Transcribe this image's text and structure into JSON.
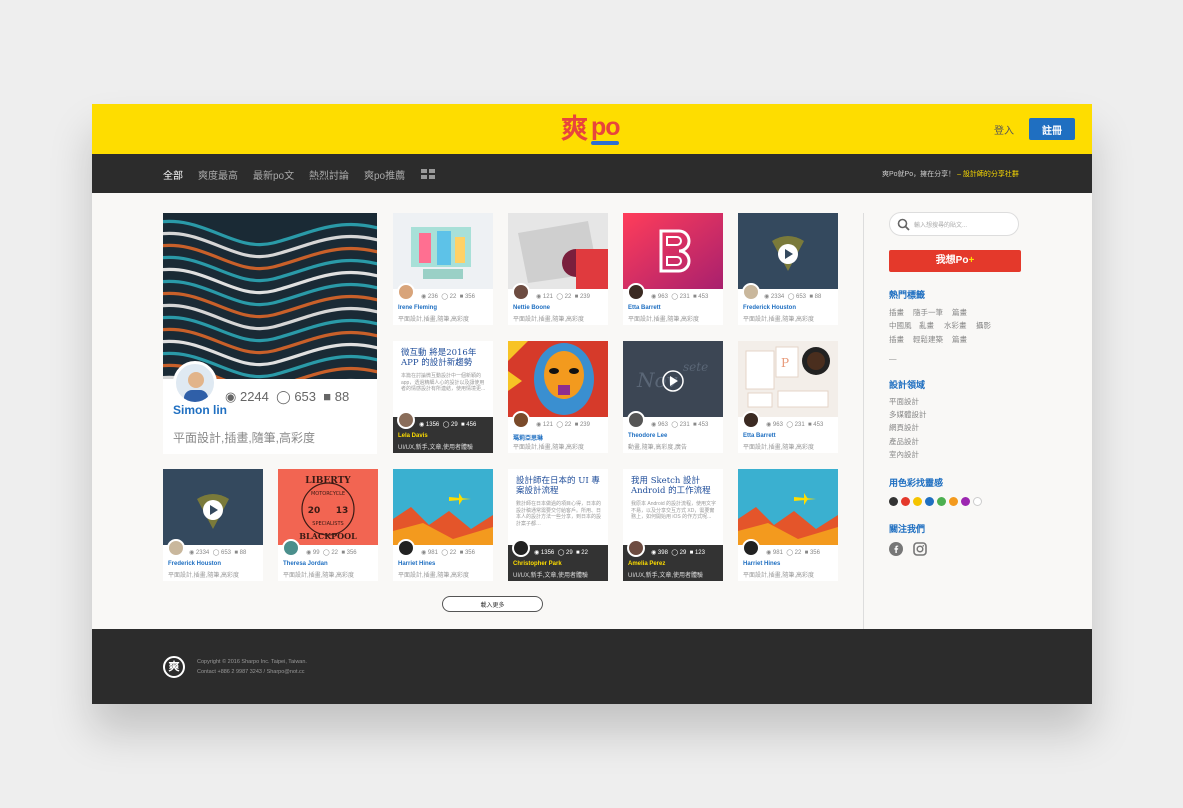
{
  "header": {
    "logo_cjk": "爽",
    "logo_po": "po",
    "login": "登入",
    "signup": "註冊"
  },
  "nav": {
    "items": [
      "全部",
      "爽度最高",
      "最新po文",
      "熱烈討論",
      "爽po推薦"
    ],
    "tagline": "爽Po就Po，擁在分享！",
    "tagline_highlight": "– 設計師的分享社群"
  },
  "big_card": {
    "views": "2244",
    "likes": "653",
    "comments": "88",
    "name": "Simon lin",
    "tags": "平面設計,插畫,隨筆,高彩度"
  },
  "cards": {
    "c1": {
      "views": "236",
      "likes": "22",
      "comments": "356",
      "name": "Irene Fleming",
      "tags": "平面設計,插畫,隨筆,高彩度"
    },
    "c2": {
      "views": "121",
      "likes": "22",
      "comments": "239",
      "name": "Nettie Boone",
      "tags": "平面設計,插畫,隨筆,高彩度"
    },
    "c3": {
      "views": "963",
      "likes": "231",
      "comments": "453",
      "name": "Etta Barrett",
      "tags": "平面設計,插畫,隨筆,高彩度"
    },
    "c4": {
      "views": "2334",
      "likes": "653",
      "comments": "88",
      "name": "Frederick Houston",
      "tags": "平面設計,插畫,隨筆,高彩度"
    },
    "c5": {
      "title": "微互動 將是2016年 APP 的設計新趨勢",
      "desc": "本篇在討論微互動設計中一個新穎的 app，透過精細人心的設計以及讓使用者的情感設計有所連結，使用情境更...",
      "views": "1356",
      "likes": "29",
      "comments": "456",
      "name": "Lela Davis",
      "tags": "UI/UX,新手,文章,使用者體驗"
    },
    "c6": {
      "views": "121",
      "likes": "22",
      "comments": "239",
      "name": "瑪莉亞思琳",
      "tags": "平面設計,插畫,隨筆,高彩度"
    },
    "c7": {
      "views": "963",
      "likes": "231",
      "comments": "453",
      "name": "Theodore Lee",
      "tags": "動畫,隨筆,高彩度,廣告"
    },
    "c8": {
      "views": "963",
      "likes": "231",
      "comments": "453",
      "name": "Etta Barrett",
      "tags": "平面設計,插畫,隨筆,高彩度"
    },
    "c9": {
      "views": "2334",
      "likes": "653",
      "comments": "88",
      "name": "Frederick Houston",
      "tags": "平面設計,插畫,隨筆,高彩度"
    },
    "c10": {
      "views": "99",
      "likes": "22",
      "comments": "356",
      "name": "Theresa Jordan",
      "tags": "平面設計,插畫,隨筆,高彩度"
    },
    "c11": {
      "views": "981",
      "likes": "22",
      "comments": "356",
      "name": "Harriet Hines",
      "tags": "平面設計,插畫,隨筆,高彩度"
    },
    "c12": {
      "title": "設計師在日本的 UI 專案設計流程",
      "desc": "數計師在日本做過的項目心得，日本的設計稿通常需要交付給客戶。所用、日本人的設計方法一些分享，到日本的設計案子都…",
      "views": "1356",
      "likes": "29",
      "comments": "22",
      "name": "Christopher Park",
      "tags": "UI/UX,新手,文章,使用者體驗"
    },
    "c13": {
      "title": "我用 Sketch 設計 Android 的工作流程",
      "desc": "我原本 Android 的設計流程，使用文字不易，以及分享交互方式 XD，需要實務上，如何開始用 iOS 的作方式呢...",
      "views": "398",
      "likes": "29",
      "comments": "123",
      "name": "Amelia Perez",
      "tags": "UI/UX,新手,文章,使用者體驗"
    },
    "c14": {
      "views": "981",
      "likes": "22",
      "comments": "356",
      "name": "Harriet Hines",
      "tags": "平面設計,插畫,隨筆,高彩度"
    }
  },
  "poster_text": {
    "top": "LIBERTY",
    "mid": "MOTORCYCLE",
    "num_a": "20",
    "num_b": "13",
    "sub": "SPECIALISTS",
    "bottom": "BLACKPOOL"
  },
  "load_more": "載入更多",
  "sidebar": {
    "search_placeholder": "輸入想搜尋的貼文...",
    "post_button": "我想Po",
    "post_plus": "+",
    "hot_tags_title": "熱門標籤",
    "hot_tags": [
      "插畫",
      "隨手一筆",
      "篇畫",
      "中國風",
      "亂畫",
      "水彩畫",
      "攝影",
      "插畫",
      "輕鬆建築",
      "篇畫"
    ],
    "dash": "—",
    "fields_title": "設計領域",
    "fields": [
      "平面設計",
      "多媒體設計",
      "網頁設計",
      "產品設計",
      "室內設計"
    ],
    "colors_title": "用色彩找靈感",
    "colors": [
      "#333333",
      "#e4392b",
      "#f5c400",
      "#1f6fc1",
      "#4caf50",
      "#f39a1e",
      "#9c27b0",
      "#ffffff"
    ],
    "follow_title": "關注我們"
  },
  "footer": {
    "logo": "爽",
    "line1": "Copyright © 2016 Sharpo Inc. Taipei, Taiwan.",
    "line2": "Contact  +886 2 9987 3243 / Sharpo@not.cc"
  }
}
